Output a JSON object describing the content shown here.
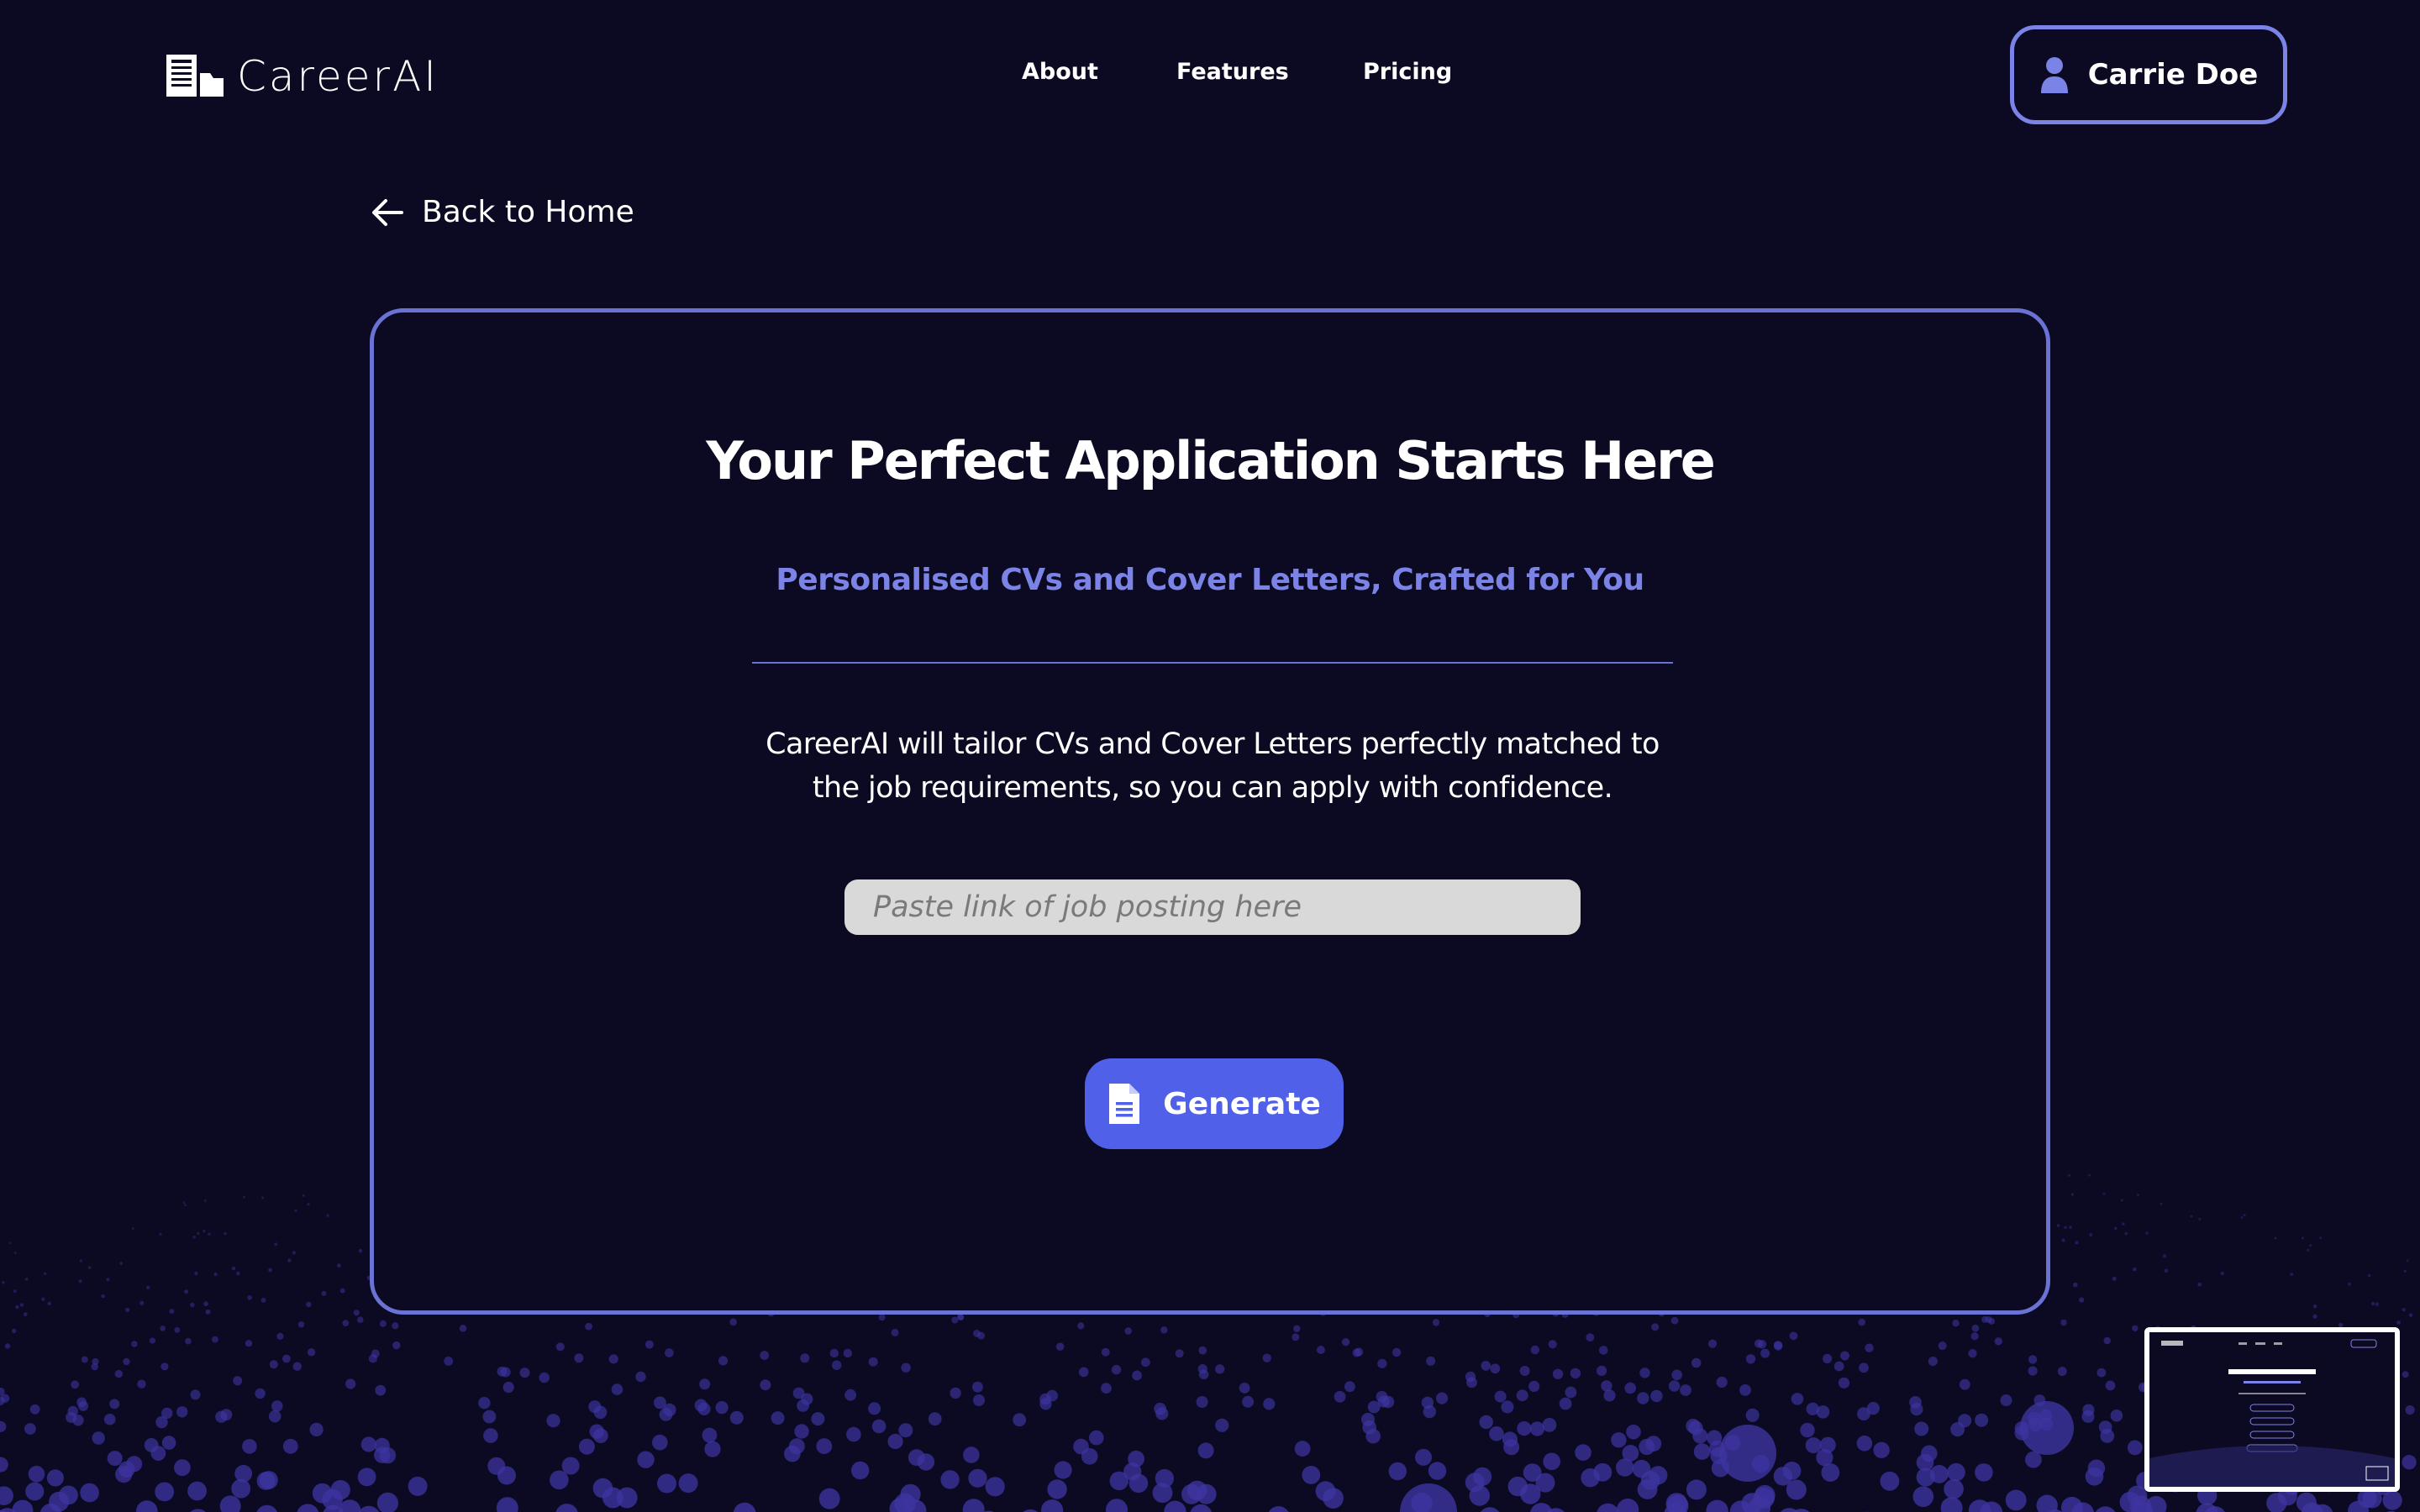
{
  "brand": {
    "name": "CareerAI",
    "logo_icon": "document-stack-logo"
  },
  "nav": {
    "items": [
      "About",
      "Features",
      "Pricing"
    ]
  },
  "profile": {
    "name": "Carrie Doe",
    "icon": "user-icon",
    "accent": "#7b84e6"
  },
  "back_link": {
    "label": "Back to Home",
    "icon": "arrow-left-icon"
  },
  "hero": {
    "title": "Your Perfect Application Starts Here",
    "subtitle": "Personalised CVs and Cover Letters, Crafted for You",
    "description": "CareerAI will tailor CVs and Cover Letters perfectly matched to the job requirements, so you can apply with confidence.",
    "input": {
      "placeholder": "Paste link of job posting here",
      "value": ""
    },
    "generate_button": {
      "label": "Generate",
      "icon": "document-icon",
      "color": "#5060e8"
    }
  },
  "thumbnail": {
    "icon": "page-preview-thumbnail"
  },
  "colors": {
    "background": "#0c0a22",
    "accent": "#6a73d4",
    "subtitle": "#7b84e6",
    "particle": "#3d34a0"
  }
}
